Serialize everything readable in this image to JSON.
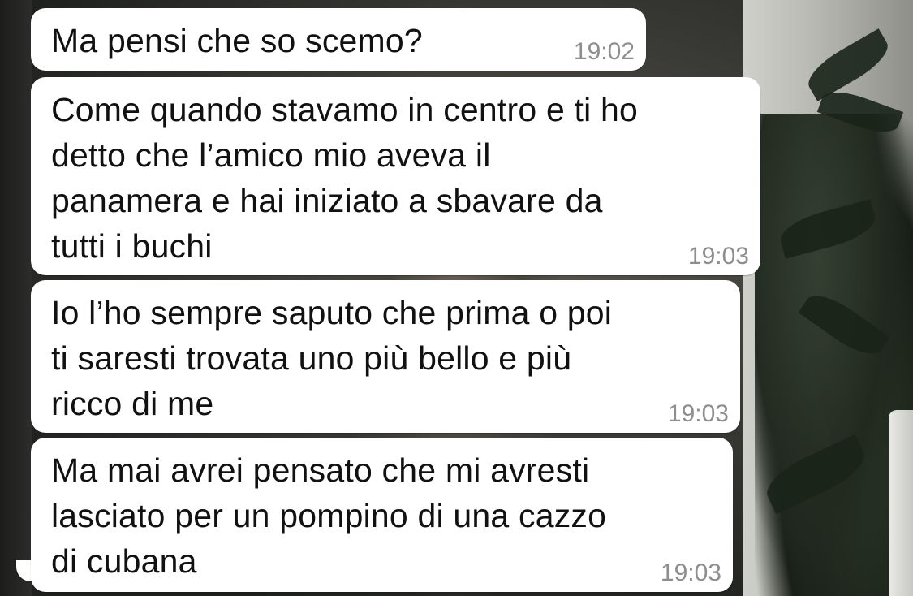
{
  "messages": [
    {
      "text": "Ma pensi che so scemo?",
      "time": "19:02"
    },
    {
      "text": "Come quando stavamo in centro e ti ho\ndetto che l’amico mio aveva il\npanamera e hai iniziato a sbavare da\ntutti i buchi",
      "time": "19:03"
    },
    {
      "text": "Io l’ho sempre saputo che prima o poi\nti saresti trovata uno più bello e più\nricco di me",
      "time": "19:03"
    },
    {
      "text": "Ma mai avrei pensato che mi avresti\nlasciato per un pompino di una cazzo\ndi cubana",
      "time": "19:03"
    }
  ],
  "colors": {
    "bubble": "#ffffff",
    "text": "#111111",
    "timestamp": "#8e8e8e"
  }
}
